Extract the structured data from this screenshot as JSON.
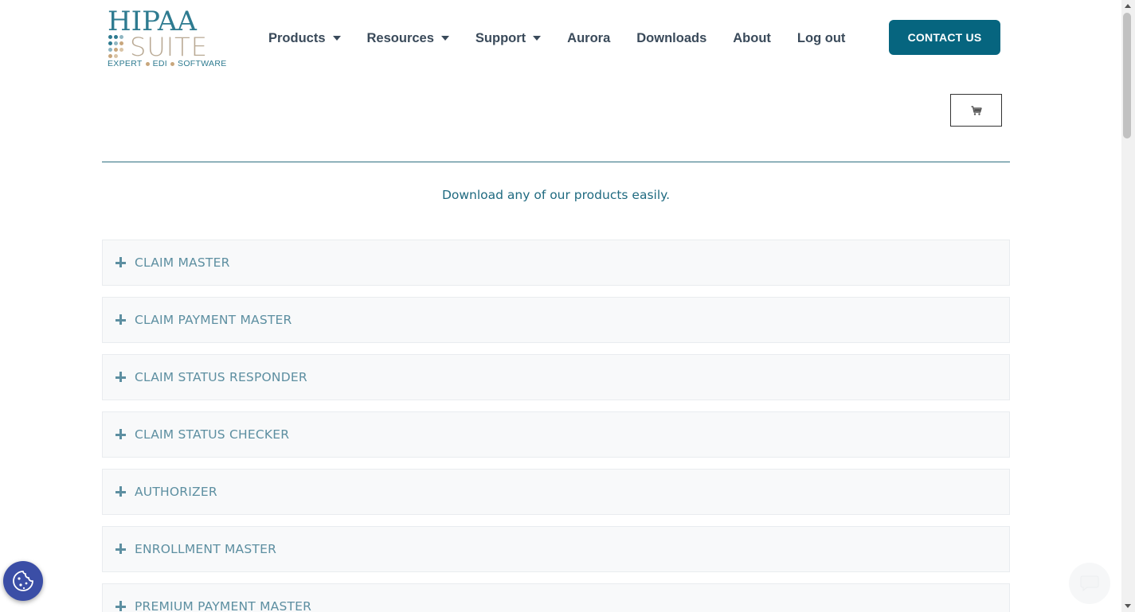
{
  "logo": {
    "top_text": "HIPAA",
    "mid_text": "SUITE",
    "tagline_1": "EXPERT",
    "tagline_2": "EDI",
    "tagline_3": "SOFTWARE"
  },
  "nav": {
    "items": [
      {
        "label": "Products",
        "has_dropdown": true
      },
      {
        "label": "Resources",
        "has_dropdown": true
      },
      {
        "label": "Support",
        "has_dropdown": true
      },
      {
        "label": "Aurora",
        "has_dropdown": false
      },
      {
        "label": "Downloads",
        "has_dropdown": false
      },
      {
        "label": "About",
        "has_dropdown": false
      },
      {
        "label": "Log out",
        "has_dropdown": false
      }
    ],
    "contact_label": "CONTACT US"
  },
  "cart": {
    "icon": "cart-icon"
  },
  "intro_text": "Download any of our products easily.",
  "accordion": {
    "items": [
      {
        "title": "CLAIM MASTER"
      },
      {
        "title": "CLAIM PAYMENT MASTER"
      },
      {
        "title": "CLAIM STATUS RESPONDER"
      },
      {
        "title": "CLAIM STATUS CHECKER"
      },
      {
        "title": "AUTHORIZER"
      },
      {
        "title": "ENROLLMENT MASTER"
      },
      {
        "title": "PREMIUM PAYMENT MASTER"
      }
    ]
  },
  "colors": {
    "brand_teal": "#06657f",
    "accordion_text": "#5d8fa1",
    "logo_tan": "#b9a994",
    "cookie_blue": "#3b4ea6"
  },
  "icons": {
    "cookie": "cookie-icon",
    "chat": "chat-icon",
    "plus": "plus-icon"
  }
}
